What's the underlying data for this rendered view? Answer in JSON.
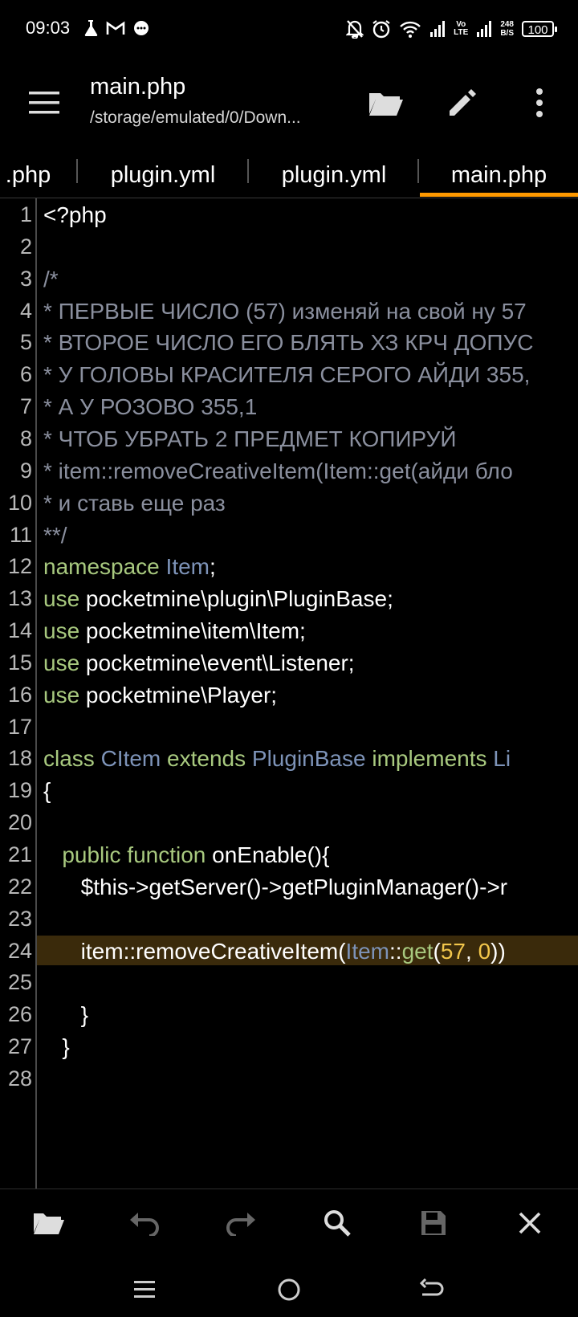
{
  "status_bar": {
    "time": "09:03",
    "network_speed_value": "248",
    "network_speed_unit": "B/S",
    "volte_top": "Vo",
    "volte_bottom": "LTE",
    "battery": "100"
  },
  "app_bar": {
    "title": "main.php",
    "path": "/storage/emulated/0/Down..."
  },
  "tabs": [
    {
      "label": ".php"
    },
    {
      "label": "plugin.yml"
    },
    {
      "label": "plugin.yml"
    },
    {
      "label": "main.php",
      "active": true
    }
  ],
  "editor": {
    "current_line": 24,
    "lines": [
      {
        "n": "1",
        "text": "<?php"
      },
      {
        "n": "2",
        "text": ""
      },
      {
        "n": "3",
        "text": "/*"
      },
      {
        "n": "4",
        "text": "* ПЕРВЫЕ ЧИСЛО (57) изменяй на свой ну 57"
      },
      {
        "n": "5",
        "text": "* ВТОРОЕ ЧИСЛО ЕГО БЛЯТЬ ХЗ КРЧ ДОПУС"
      },
      {
        "n": "6",
        "text": "* У ГОЛОВЫ КРАСИТЕЛЯ СЕРОГО АЙДИ 355,"
      },
      {
        "n": "7",
        "text": "* А У РОЗОВО 355,1"
      },
      {
        "n": "8",
        "text": "* ЧТОБ УБРАТЬ 2 ПРЕДМЕТ КОПИРУЙ"
      },
      {
        "n": "9",
        "text": "* item::removeCreativeItem(Item::get(айди бло"
      },
      {
        "n": "10",
        "text": "* и ставь еще раз"
      },
      {
        "n": "11",
        "text": "**/"
      },
      {
        "n": "12",
        "tokens": [
          [
            "kw",
            "namespace"
          ],
          [
            "plain",
            " "
          ],
          [
            "ty",
            "Item"
          ],
          [
            "plain",
            ";"
          ]
        ]
      },
      {
        "n": "13",
        "tokens": [
          [
            "kw",
            "use"
          ],
          [
            "plain",
            " pocketmine\\plugin\\PluginBase;"
          ]
        ]
      },
      {
        "n": "14",
        "tokens": [
          [
            "kw",
            "use"
          ],
          [
            "plain",
            " pocketmine\\item\\Item;"
          ]
        ]
      },
      {
        "n": "15",
        "tokens": [
          [
            "kw",
            "use"
          ],
          [
            "plain",
            " pocketmine\\event\\Listener;"
          ]
        ]
      },
      {
        "n": "16",
        "tokens": [
          [
            "kw",
            "use"
          ],
          [
            "plain",
            " pocketmine\\Player;"
          ]
        ]
      },
      {
        "n": "17",
        "text": ""
      },
      {
        "n": "18",
        "tokens": [
          [
            "kw",
            "class"
          ],
          [
            "plain",
            " "
          ],
          [
            "ty",
            "CItem"
          ],
          [
            "plain",
            " "
          ],
          [
            "kw",
            "extends"
          ],
          [
            "plain",
            " "
          ],
          [
            "ty",
            "PluginBase"
          ],
          [
            "plain",
            " "
          ],
          [
            "kw",
            "implements"
          ],
          [
            "plain",
            " "
          ],
          [
            "ty",
            "Li"
          ]
        ]
      },
      {
        "n": "19",
        "tokens": [
          [
            "plain",
            "{"
          ]
        ]
      },
      {
        "n": "20",
        "text": ""
      },
      {
        "n": "21",
        "tokens": [
          [
            "plain",
            "   "
          ],
          [
            "kw",
            "public"
          ],
          [
            "plain",
            " "
          ],
          [
            "kw",
            "function"
          ],
          [
            "plain",
            " onEnable(){"
          ]
        ]
      },
      {
        "n": "22",
        "tokens": [
          [
            "plain",
            "      $this->getServer()->getPluginManager()->r"
          ]
        ]
      },
      {
        "n": "23",
        "text": ""
      },
      {
        "n": "24",
        "tokens": [
          [
            "plain",
            "      item::removeCreativeItem("
          ],
          [
            "ty",
            "Item"
          ],
          [
            "plain",
            "::"
          ],
          [
            "kw",
            "get"
          ],
          [
            "plain",
            "("
          ],
          [
            "num",
            "57"
          ],
          [
            "plain",
            ", "
          ],
          [
            "num",
            "0"
          ],
          [
            "plain",
            "))"
          ]
        ]
      },
      {
        "n": "25",
        "text": ""
      },
      {
        "n": "26",
        "tokens": [
          [
            "plain",
            "      }"
          ]
        ]
      },
      {
        "n": "27",
        "tokens": [
          [
            "plain",
            "   }"
          ]
        ]
      },
      {
        "n": "28",
        "text": ""
      }
    ]
  },
  "bottom_toolbar": [
    "folder-open",
    "undo",
    "redo",
    "search",
    "save",
    "close"
  ],
  "nav_bar": [
    "recents",
    "home",
    "back"
  ]
}
